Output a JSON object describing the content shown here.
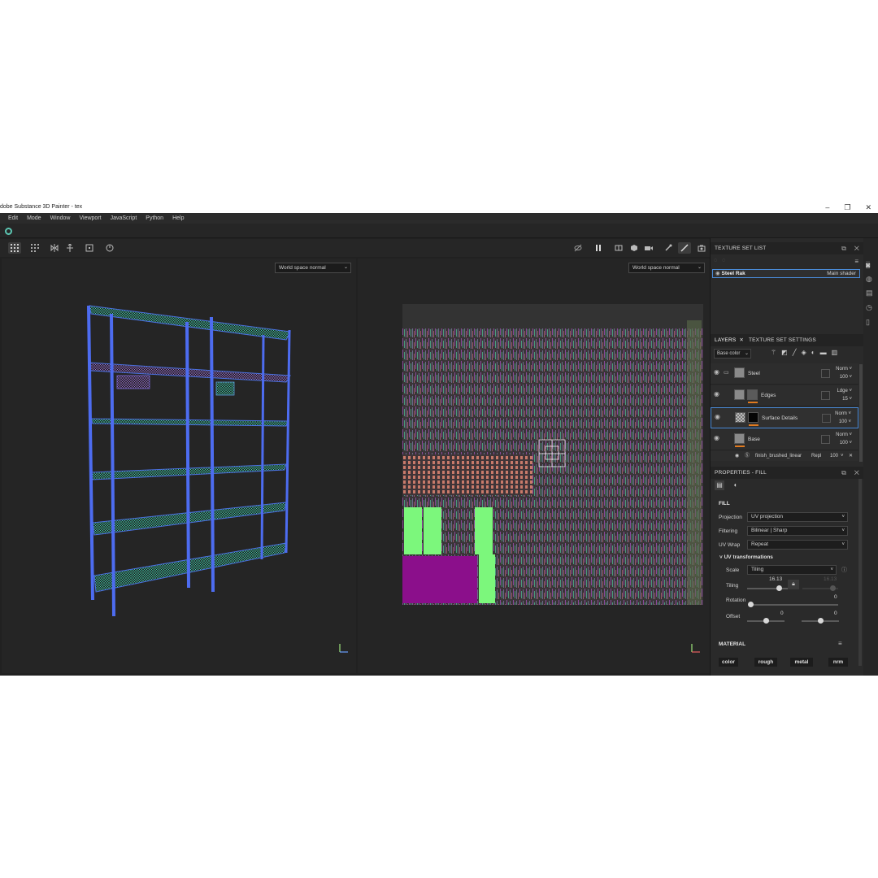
{
  "window": {
    "title": "dobe Substance 3D Painter - tex",
    "minimize": "–",
    "maximize": "❐",
    "close": "✕"
  },
  "menu": [
    "Edit",
    "Mode",
    "Window",
    "Viewport",
    "JavaScript",
    "Python",
    "Help"
  ],
  "viewport3d": {
    "channel": "World space normal"
  },
  "viewport2d": {
    "channel": "World space normal"
  },
  "texture_set_list": {
    "title": "TEXTURE SET LIST",
    "set_name": "Steel Rak",
    "shader": "Main shader"
  },
  "layers_panel": {
    "tab_layers": "LAYERS",
    "tab_settings": "TEXTURE SET SETTINGS",
    "channel": "Base color",
    "layers": [
      {
        "name": "Steel",
        "blend": "Norm",
        "opacity": "100",
        "type": "folder"
      },
      {
        "name": "Edges",
        "blend": "Ldge",
        "opacity": "15",
        "type": "mask"
      },
      {
        "name": "Surface Details",
        "blend": "Norm",
        "opacity": "100",
        "type": "fill"
      },
      {
        "name": "Base",
        "blend": "Norm",
        "opacity": "100",
        "type": "fill"
      }
    ],
    "effect": {
      "name": "finish_brushed_linear",
      "blend": "Repl",
      "opacity": "100"
    }
  },
  "properties": {
    "title": "PROPERTIES - FILL",
    "section_fill": "FILL",
    "projection_label": "Projection",
    "projection": "UV projection",
    "filtering_label": "Filtering",
    "filtering": "Bilinear | Sharp",
    "uvwrap_label": "UV Wrap",
    "uvwrap": "Repeat",
    "uv_transformations": "UV transformations",
    "scale_label": "Scale",
    "scale": "Tiling",
    "tiling_label": "Tiling",
    "tiling_u": "16.13",
    "tiling_v": "16.13",
    "rotation_label": "Rotation",
    "rotation": "0",
    "offset_label": "Offset",
    "offset_u": "0",
    "offset_v": "0",
    "section_material": "MATERIAL",
    "material_buttons": [
      "color",
      "rough",
      "metal",
      "nrm"
    ]
  },
  "colors": {
    "accent": "#4a8bd8",
    "orange": "#e07a1f",
    "uv_green": "#7cf77c",
    "uv_purple": "#8b0f8b",
    "wire": "#4a70e0"
  }
}
